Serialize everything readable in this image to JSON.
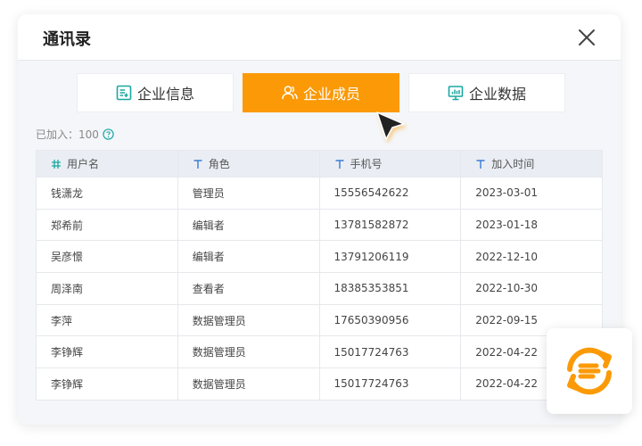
{
  "dialog": {
    "title": "通讯录"
  },
  "tabs": [
    {
      "label": "企业信息",
      "icon": "info-doc-icon",
      "active": false
    },
    {
      "label": "企业成员",
      "icon": "members-icon",
      "active": true
    },
    {
      "label": "企业数据",
      "icon": "monitor-chart-icon",
      "active": false
    }
  ],
  "summary": {
    "joined_label": "已加入：100"
  },
  "table": {
    "columns": [
      "用户名",
      "角色",
      "手机号",
      "加入时间"
    ],
    "rows": [
      [
        "钱潇龙",
        "管理员",
        "15556542622",
        "2023-03-01"
      ],
      [
        "郑希前",
        "编辑者",
        "13781582872",
        "2023-01-18"
      ],
      [
        "吴彦憬",
        "编辑者",
        "13791206119",
        "2022-12-10"
      ],
      [
        "周泽南",
        "查看者",
        "18385353851",
        "2022-10-30"
      ],
      [
        "李萍",
        "数据管理员",
        "17650390956",
        "2022-09-15"
      ],
      [
        "李铮辉",
        "数据管理员",
        "15017724763",
        "2022-04-22"
      ],
      [
        "李铮辉",
        "数据管理员",
        "15017724763",
        "2022-04-22"
      ]
    ]
  },
  "colors": {
    "accent": "#fb9a06",
    "teal_icon": "#1aa7a0",
    "blue_icon": "#3a7bd5"
  }
}
